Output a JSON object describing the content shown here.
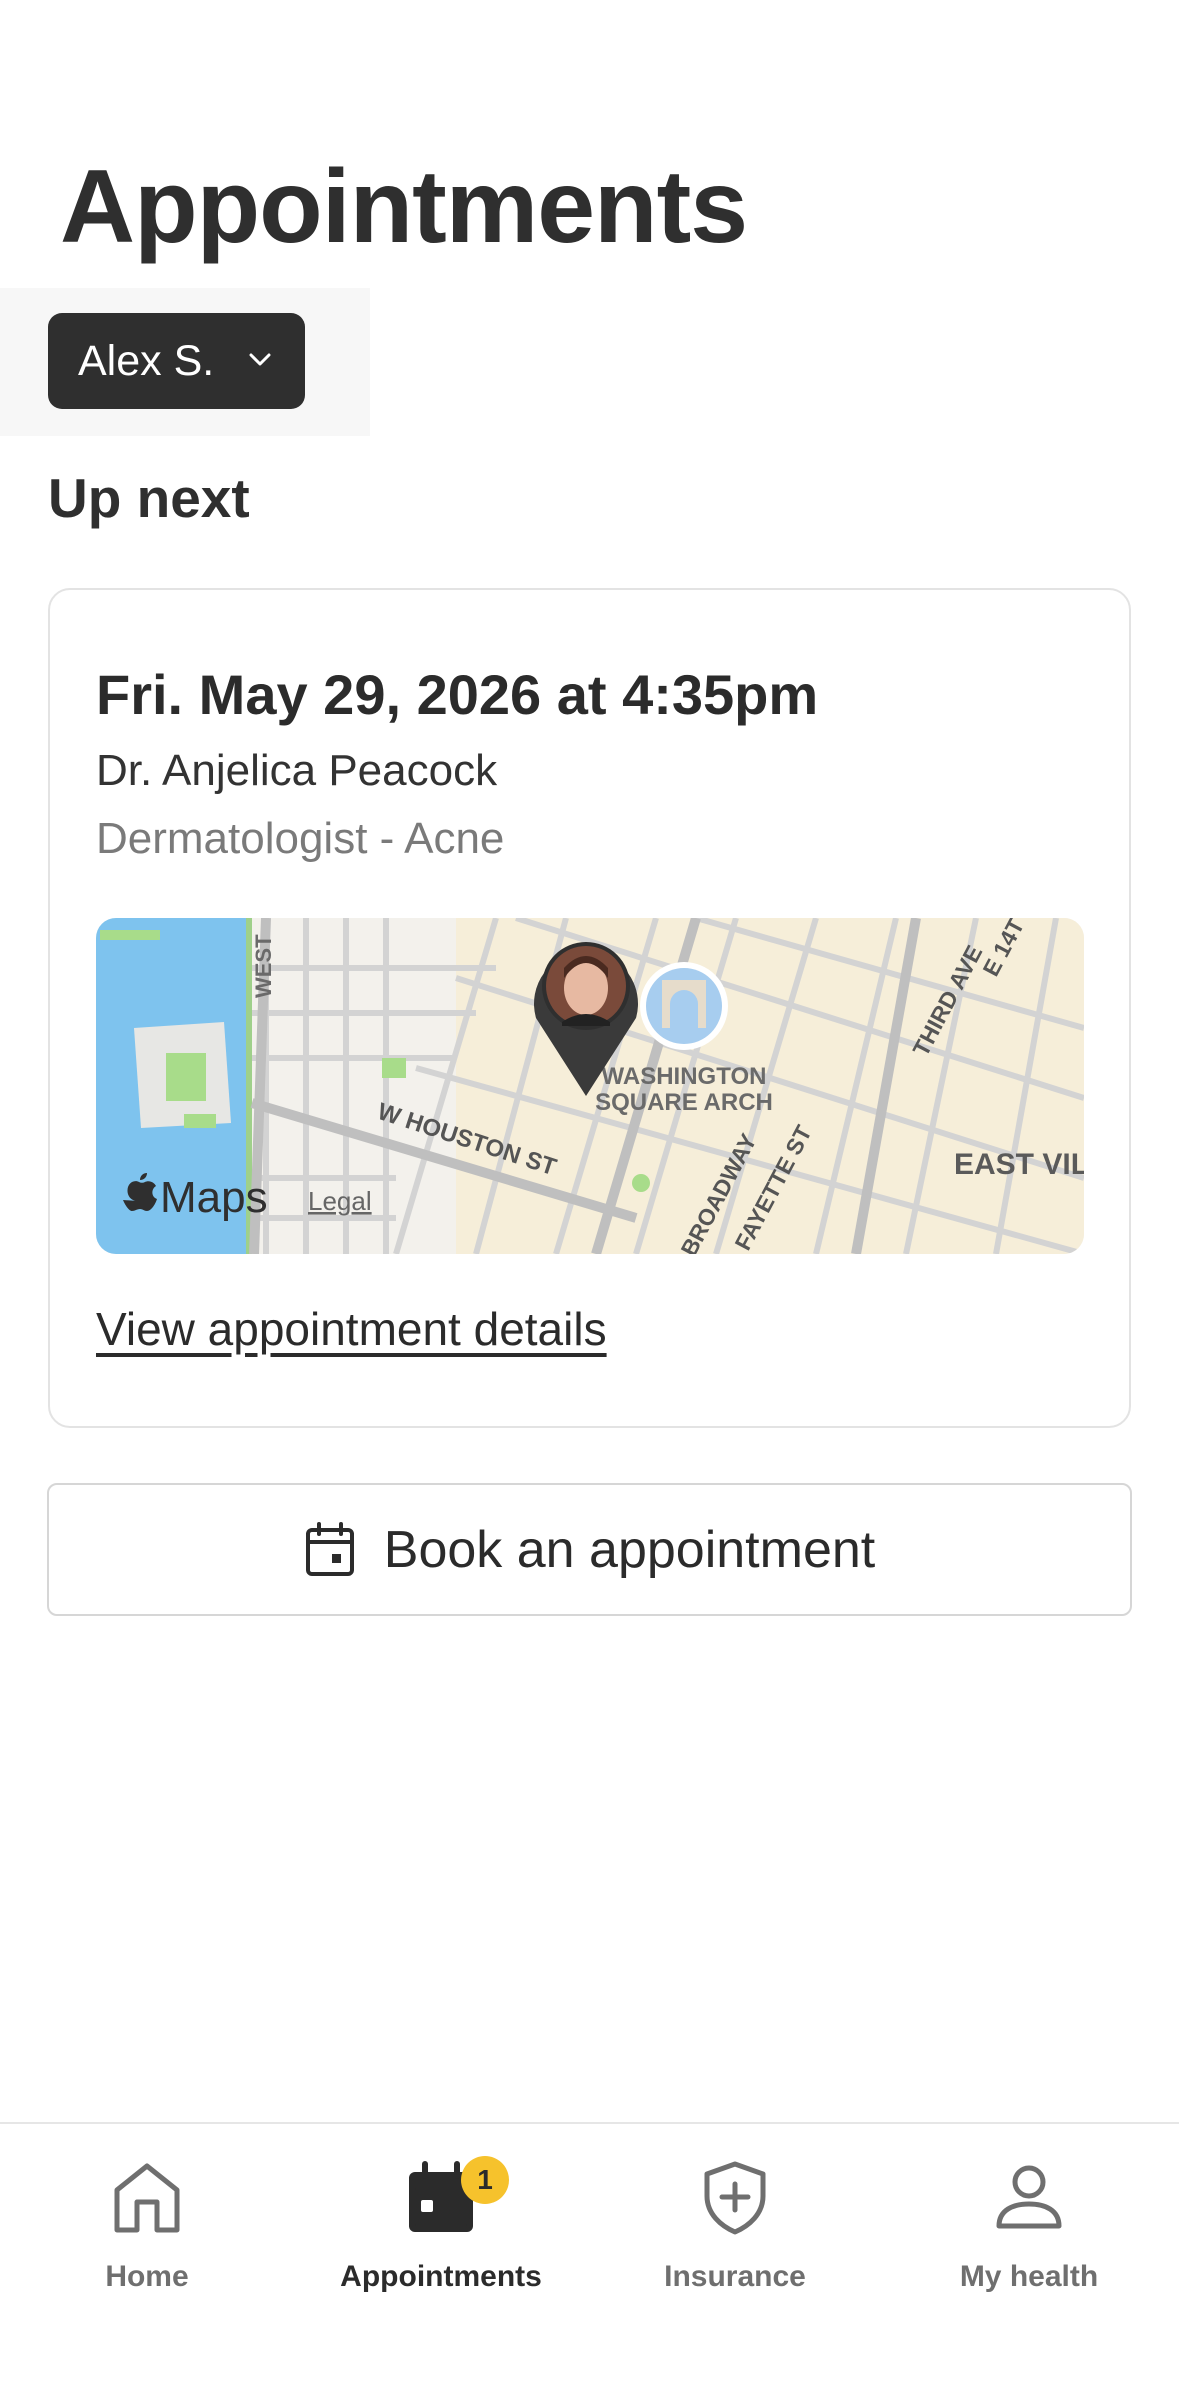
{
  "header": {
    "title": "Appointments"
  },
  "patient_selector": {
    "name": "Alex S."
  },
  "up_next": {
    "section_title": "Up next",
    "appointment": {
      "datetime": "Fri. May 29, 2026 at 4:35pm",
      "doctor": "Dr. Anjelica Peacock",
      "specialty": "Dermatologist - Acne",
      "map": {
        "streets": [
          "WEST",
          "W HOUSTON ST",
          "BROADWAY",
          "FAYETTE ST",
          "THIRD AVE",
          "E 14T",
          "EAST VIL"
        ],
        "landmark": [
          "WASHINGTON",
          "SQUARE ARCH"
        ],
        "provider_logo": "Maps",
        "legal": "Legal"
      },
      "details_link": "View appointment details"
    }
  },
  "book_button": {
    "label": "Book an appointment"
  },
  "tabbar": {
    "items": [
      {
        "label": "Home",
        "icon": "home-icon",
        "active": false
      },
      {
        "label": "Appointments",
        "icon": "calendar-icon",
        "active": true,
        "badge": "1"
      },
      {
        "label": "Insurance",
        "icon": "shield-plus-icon",
        "active": false
      },
      {
        "label": "My health",
        "icon": "person-icon",
        "active": false
      }
    ]
  },
  "colors": {
    "dark": "#2f2f2f",
    "muted": "#7a7a7a",
    "badge": "#f6c22c",
    "water": "#7ec3ee",
    "park": "#a8dc8a"
  }
}
